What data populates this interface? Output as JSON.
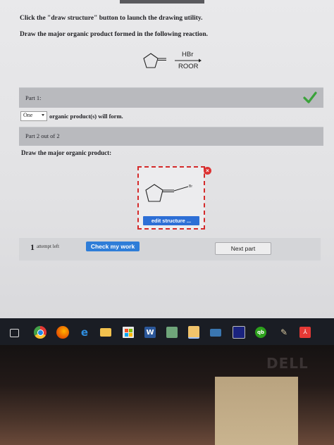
{
  "instructions": {
    "line1": "Click the \"draw structure\" button to launch the drawing utility.",
    "line2": "Draw the major organic product formed in the following reaction."
  },
  "reaction": {
    "reagent_top": "HBr",
    "reagent_bottom": "ROOR"
  },
  "part1": {
    "label": "Part 1:",
    "status_icon": "checkmark-icon",
    "select_value": "One",
    "suffix": "organic product(s) will form."
  },
  "part2": {
    "label": "Part 2 out of 2",
    "prompt": "Draw the major organic product:",
    "atom_label": "Br",
    "edit_button": "edit structure ...",
    "close_icon": "×"
  },
  "footer": {
    "attempts_count": "1",
    "attempts_text": "attempt left",
    "check_button": "Check my work",
    "next_button": "Next part"
  },
  "taskbar_icons": [
    "task-view-icon",
    "chrome-icon",
    "firefox-icon",
    "edge-icon",
    "file-explorer-icon",
    "store-icon",
    "word-icon",
    "excel-icon",
    "photos-icon",
    "mail-icon",
    "monitor-icon",
    "quickbooks-icon",
    "tool-icon",
    "acrobat-icon"
  ],
  "monitor": {
    "brand": "DELL"
  },
  "colors": {
    "accent_blue": "#2e7dd8",
    "check_green": "#3aa23a",
    "error_red": "#d33333"
  }
}
